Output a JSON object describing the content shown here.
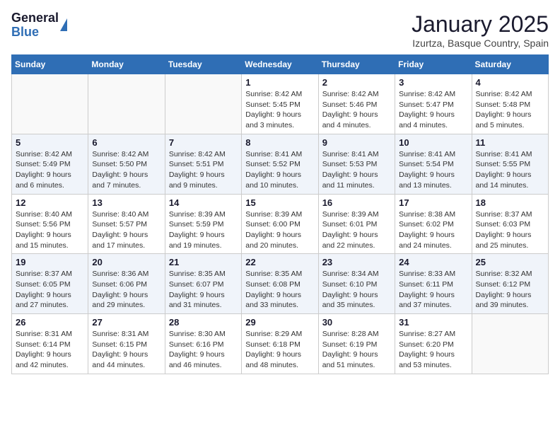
{
  "logo": {
    "general": "General",
    "blue": "Blue"
  },
  "title": {
    "month": "January 2025",
    "location": "Izurtza, Basque Country, Spain"
  },
  "days_of_week": [
    "Sunday",
    "Monday",
    "Tuesday",
    "Wednesday",
    "Thursday",
    "Friday",
    "Saturday"
  ],
  "weeks": [
    [
      {
        "day": "",
        "info": ""
      },
      {
        "day": "",
        "info": ""
      },
      {
        "day": "",
        "info": ""
      },
      {
        "day": "1",
        "info": "Sunrise: 8:42 AM\nSunset: 5:45 PM\nDaylight: 9 hours and 3 minutes."
      },
      {
        "day": "2",
        "info": "Sunrise: 8:42 AM\nSunset: 5:46 PM\nDaylight: 9 hours and 4 minutes."
      },
      {
        "day": "3",
        "info": "Sunrise: 8:42 AM\nSunset: 5:47 PM\nDaylight: 9 hours and 4 minutes."
      },
      {
        "day": "4",
        "info": "Sunrise: 8:42 AM\nSunset: 5:48 PM\nDaylight: 9 hours and 5 minutes."
      }
    ],
    [
      {
        "day": "5",
        "info": "Sunrise: 8:42 AM\nSunset: 5:49 PM\nDaylight: 9 hours and 6 minutes."
      },
      {
        "day": "6",
        "info": "Sunrise: 8:42 AM\nSunset: 5:50 PM\nDaylight: 9 hours and 7 minutes."
      },
      {
        "day": "7",
        "info": "Sunrise: 8:42 AM\nSunset: 5:51 PM\nDaylight: 9 hours and 9 minutes."
      },
      {
        "day": "8",
        "info": "Sunrise: 8:41 AM\nSunset: 5:52 PM\nDaylight: 9 hours and 10 minutes."
      },
      {
        "day": "9",
        "info": "Sunrise: 8:41 AM\nSunset: 5:53 PM\nDaylight: 9 hours and 11 minutes."
      },
      {
        "day": "10",
        "info": "Sunrise: 8:41 AM\nSunset: 5:54 PM\nDaylight: 9 hours and 13 minutes."
      },
      {
        "day": "11",
        "info": "Sunrise: 8:41 AM\nSunset: 5:55 PM\nDaylight: 9 hours and 14 minutes."
      }
    ],
    [
      {
        "day": "12",
        "info": "Sunrise: 8:40 AM\nSunset: 5:56 PM\nDaylight: 9 hours and 15 minutes."
      },
      {
        "day": "13",
        "info": "Sunrise: 8:40 AM\nSunset: 5:57 PM\nDaylight: 9 hours and 17 minutes."
      },
      {
        "day": "14",
        "info": "Sunrise: 8:39 AM\nSunset: 5:59 PM\nDaylight: 9 hours and 19 minutes."
      },
      {
        "day": "15",
        "info": "Sunrise: 8:39 AM\nSunset: 6:00 PM\nDaylight: 9 hours and 20 minutes."
      },
      {
        "day": "16",
        "info": "Sunrise: 8:39 AM\nSunset: 6:01 PM\nDaylight: 9 hours and 22 minutes."
      },
      {
        "day": "17",
        "info": "Sunrise: 8:38 AM\nSunset: 6:02 PM\nDaylight: 9 hours and 24 minutes."
      },
      {
        "day": "18",
        "info": "Sunrise: 8:37 AM\nSunset: 6:03 PM\nDaylight: 9 hours and 25 minutes."
      }
    ],
    [
      {
        "day": "19",
        "info": "Sunrise: 8:37 AM\nSunset: 6:05 PM\nDaylight: 9 hours and 27 minutes."
      },
      {
        "day": "20",
        "info": "Sunrise: 8:36 AM\nSunset: 6:06 PM\nDaylight: 9 hours and 29 minutes."
      },
      {
        "day": "21",
        "info": "Sunrise: 8:35 AM\nSunset: 6:07 PM\nDaylight: 9 hours and 31 minutes."
      },
      {
        "day": "22",
        "info": "Sunrise: 8:35 AM\nSunset: 6:08 PM\nDaylight: 9 hours and 33 minutes."
      },
      {
        "day": "23",
        "info": "Sunrise: 8:34 AM\nSunset: 6:10 PM\nDaylight: 9 hours and 35 minutes."
      },
      {
        "day": "24",
        "info": "Sunrise: 8:33 AM\nSunset: 6:11 PM\nDaylight: 9 hours and 37 minutes."
      },
      {
        "day": "25",
        "info": "Sunrise: 8:32 AM\nSunset: 6:12 PM\nDaylight: 9 hours and 39 minutes."
      }
    ],
    [
      {
        "day": "26",
        "info": "Sunrise: 8:31 AM\nSunset: 6:14 PM\nDaylight: 9 hours and 42 minutes."
      },
      {
        "day": "27",
        "info": "Sunrise: 8:31 AM\nSunset: 6:15 PM\nDaylight: 9 hours and 44 minutes."
      },
      {
        "day": "28",
        "info": "Sunrise: 8:30 AM\nSunset: 6:16 PM\nDaylight: 9 hours and 46 minutes."
      },
      {
        "day": "29",
        "info": "Sunrise: 8:29 AM\nSunset: 6:18 PM\nDaylight: 9 hours and 48 minutes."
      },
      {
        "day": "30",
        "info": "Sunrise: 8:28 AM\nSunset: 6:19 PM\nDaylight: 9 hours and 51 minutes."
      },
      {
        "day": "31",
        "info": "Sunrise: 8:27 AM\nSunset: 6:20 PM\nDaylight: 9 hours and 53 minutes."
      },
      {
        "day": "",
        "info": ""
      }
    ]
  ]
}
